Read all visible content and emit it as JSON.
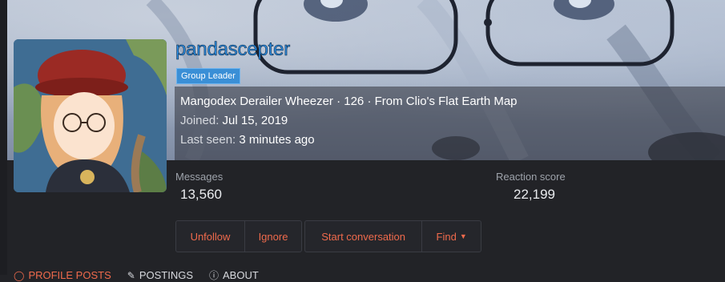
{
  "profile": {
    "username": "pandascepter",
    "badge": "Group Leader",
    "title_line": "Mangodex Derailer Wheezer · 126 · From Clio's Flat Earth Map",
    "joined_label": "Joined:",
    "joined_value": "Jul 15, 2019",
    "last_seen_label": "Last seen:",
    "last_seen_value": "3 minutes ago"
  },
  "stats": {
    "messages_label": "Messages",
    "messages_value": "13,560",
    "reaction_label": "Reaction score",
    "reaction_value": "22,199"
  },
  "actions": {
    "unfollow": "Unfollow",
    "ignore": "Ignore",
    "start_conversation": "Start conversation",
    "find": "Find"
  },
  "tabs": [
    {
      "label": "PROFILE POSTS",
      "icon": "comment-icon"
    },
    {
      "label": "POSTINGS",
      "icon": "edit-icon"
    },
    {
      "label": "ABOUT",
      "icon": "info-icon"
    }
  ],
  "colors": {
    "accent": "#ef6a4c",
    "username": "#2d8fe6",
    "badge": "#3a8fd6"
  }
}
